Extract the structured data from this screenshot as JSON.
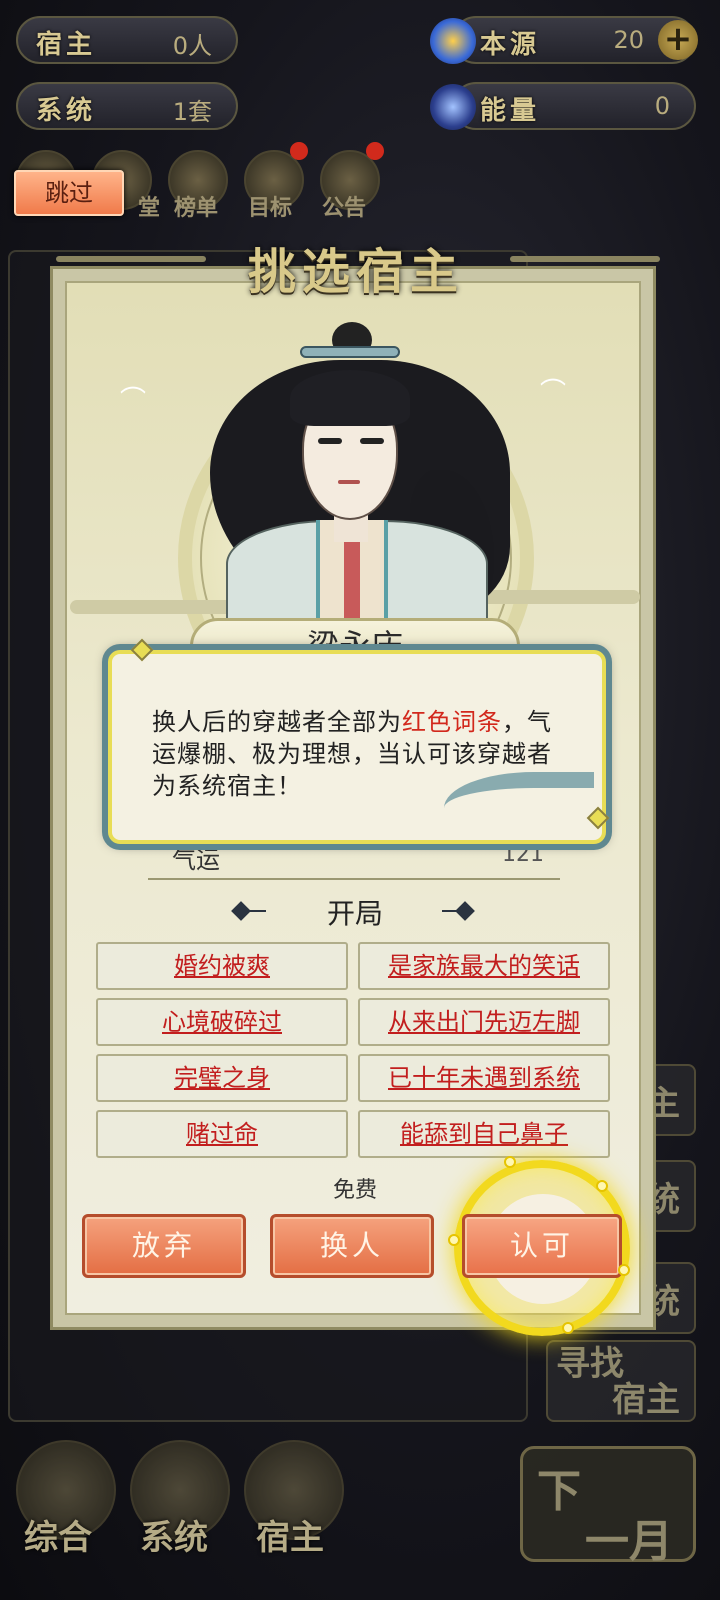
{
  "top_stats": {
    "host_label": "宿主",
    "host_value": "0人",
    "system_label": "系统",
    "system_value": "1套",
    "origin_label": "本源",
    "origin_value": "20",
    "energy_label": "能量",
    "energy_value": "0"
  },
  "top_menu": {
    "items": [
      {
        "label": "堂",
        "icon": "hall-icon"
      },
      {
        "label": "榜单",
        "icon": "ranking-icon"
      },
      {
        "label": "目标",
        "icon": "target-icon"
      },
      {
        "label": "公告",
        "icon": "notice-icon"
      }
    ]
  },
  "skip_label": "跳过",
  "side_buttons": [
    "主",
    "统",
    "统"
  ],
  "find_host": {
    "line1": "寻找",
    "line2": "宿主"
  },
  "dialog": {
    "title": "挑选宿主",
    "character_name": "梁永庆",
    "tooltip": {
      "before": "换人后的穿越者全部为",
      "highlight": "红色词条",
      "after": "，气运爆棚、极为理想，当认可该穿越者为系统宿主！"
    },
    "luck_label": "气运",
    "luck_value": "121",
    "opening_title": "开局",
    "traits": [
      "婚约被爽",
      "是家族最大的笑话",
      "心境破碎过",
      "从来出门先迈左脚",
      "完璧之身",
      "已十年未遇到系统",
      "赌过命",
      "能舔到自己鼻子"
    ],
    "free_label": "免费",
    "abandon_label": "放弃",
    "swap_label": "换人",
    "approve_label": "认可"
  },
  "bottom_nav": [
    {
      "label": "综合",
      "icon": "general-icon"
    },
    {
      "label": "系统",
      "icon": "system-icon"
    },
    {
      "label": "宿主",
      "icon": "host-icon"
    }
  ],
  "next_month": {
    "line1": "下",
    "line2": "一月"
  },
  "colors": {
    "accent_gold": "#f2d91e",
    "trait_red": "#c21e1e",
    "button_orange": "#e46e44"
  }
}
